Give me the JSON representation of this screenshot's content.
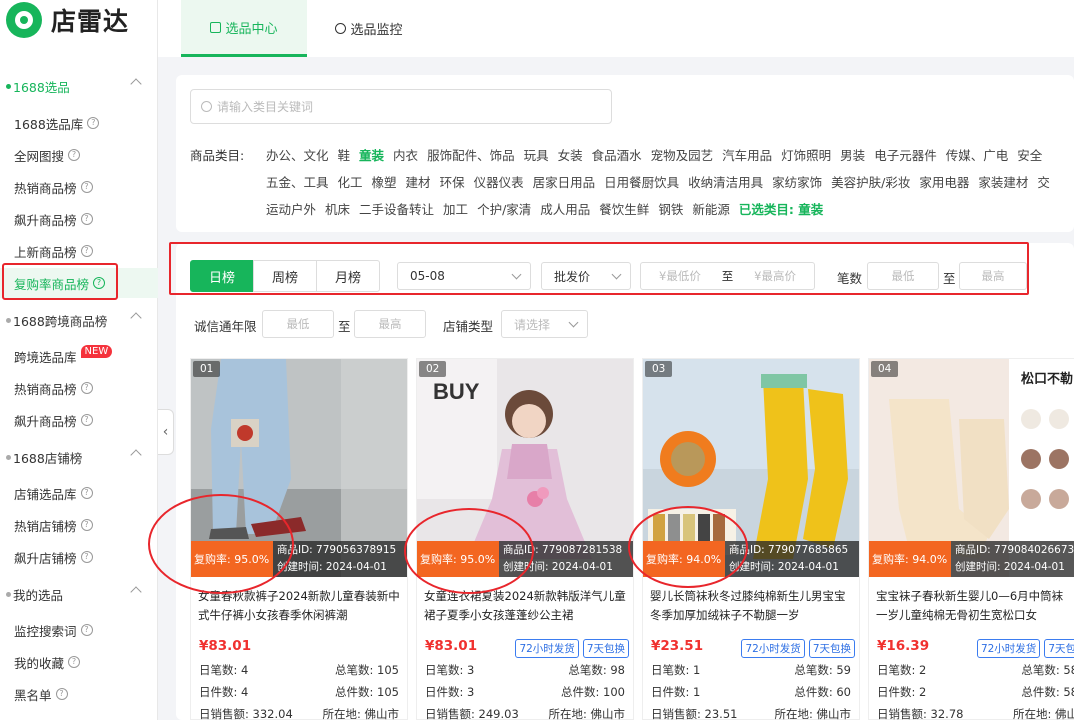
{
  "app": {
    "name": "店雷达"
  },
  "tabs": [
    {
      "label": "选品中心"
    },
    {
      "label": "选品监控"
    }
  ],
  "sidebar": {
    "groups": [
      {
        "label": "1688选品",
        "items": [
          {
            "label": "1688选品库"
          },
          {
            "label": "全网图搜"
          },
          {
            "label": "热销商品榜"
          },
          {
            "label": "飙升商品榜"
          },
          {
            "label": "上新商品榜"
          },
          {
            "label": "复购率商品榜"
          }
        ]
      },
      {
        "label": "1688跨境商品榜",
        "items": [
          {
            "label": "跨境选品库",
            "badge": "NEW"
          },
          {
            "label": "热销商品榜"
          },
          {
            "label": "飙升商品榜"
          }
        ]
      },
      {
        "label": "1688店铺榜",
        "items": [
          {
            "label": "店铺选品库"
          },
          {
            "label": "热销店铺榜"
          },
          {
            "label": "飙升店铺榜"
          }
        ]
      },
      {
        "label": "我的选品",
        "items": [
          {
            "label": "监控搜索词"
          },
          {
            "label": "我的收藏"
          },
          {
            "label": "黑名单"
          }
        ]
      }
    ],
    "help_glyph": "?",
    "collapse_glyph": "‹"
  },
  "search": {
    "placeholder": "请输入类目关键词"
  },
  "categories": {
    "label": "商品类目:",
    "row1": [
      "办公、文化",
      "鞋",
      "童装",
      "内衣",
      "服饰配件、饰品",
      "玩具",
      "女装",
      "食品酒水",
      "宠物及园艺",
      "汽车用品",
      "灯饰照明",
      "男装",
      "电子元器件",
      "传媒、广电",
      "安全"
    ],
    "row2": [
      "五金、工具",
      "化工",
      "橡塑",
      "建材",
      "环保",
      "仪器仪表",
      "居家日用品",
      "日用餐厨饮具",
      "收纳清洁用具",
      "家纺家饰",
      "美容护肤/彩妆",
      "家用电器",
      "家装建材",
      "交"
    ],
    "row3": [
      "运动户外",
      "机床",
      "二手设备转让",
      "加工",
      "个护/家清",
      "成人用品",
      "餐饮生鲜",
      "钢铁",
      "新能源"
    ],
    "selected": "童装",
    "chosen_text": "已选类目: 童装"
  },
  "filters": {
    "periods": [
      "日榜",
      "周榜",
      "月榜"
    ],
    "active_period": "日榜",
    "date": "05-08",
    "price_type": "批发价",
    "price_min": "¥最低价",
    "price_max": "¥最高价",
    "to": "至",
    "orders_label": "笔数",
    "orders_min": "最低",
    "orders_max": "最高",
    "cxt_label": "诚信通年限",
    "cxt_min": "最低",
    "cxt_max": "最高",
    "shop_type_label": "店铺类型",
    "shop_type_placeholder": "请选择"
  },
  "products": [
    {
      "rank": "01",
      "rate": "复购率: 95.0%",
      "id": "商品ID: 779056378915",
      "created": "创建时间: 2024-04-01",
      "title": "女童春秋款裤子2024新款儿童春装新中式牛仔裤小女孩春季休闲裤潮",
      "price": "¥83.01",
      "tags": [],
      "day_orders": "日笔数: 4",
      "total_orders": "总笔数: 105",
      "day_pieces": "日件数: 4",
      "total_pieces": "总件数: 105",
      "day_sales": "日销售额: 332.04",
      "location": "所在地: 佛山市"
    },
    {
      "rank": "02",
      "rate": "复购率: 95.0%",
      "id": "商品ID: 779087281538",
      "created": "创建时间: 2024-04-01",
      "title": "女童连衣裙夏装2024新款韩版洋气儿童裙子夏季小女孩蓬蓬纱公主裙",
      "price": "¥83.01",
      "tags": [
        "72小时发货",
        "7天包换"
      ],
      "day_orders": "日笔数: 3",
      "total_orders": "总笔数: 98",
      "day_pieces": "日件数: 3",
      "total_pieces": "总件数: 100",
      "day_sales": "日销售额: 249.03",
      "location": "所在地: 佛山市"
    },
    {
      "rank": "03",
      "rate": "复购率: 94.0%",
      "id": "商品ID: 779077685865",
      "created": "创建时间: 2024-04-01",
      "title": "婴儿长筒袜秋冬过膝纯棉新生儿男宝宝冬季加厚加绒袜子不勒腿一岁",
      "price": "¥23.51",
      "tags": [
        "72小时发货",
        "7天包换"
      ],
      "day_orders": "日笔数: 1",
      "total_orders": "总笔数: 59",
      "day_pieces": "日件数: 1",
      "total_pieces": "总件数: 60",
      "day_sales": "日销售额: 23.51",
      "location": "所在地: 佛山市"
    },
    {
      "rank": "04",
      "rate": "复购率: 94.0%",
      "id": "商品ID: 779084026673",
      "created": "创建时间: 2024-04-01",
      "title": "宝宝袜子春秋新生婴儿0—6月中筒袜一岁儿童纯棉无骨初生宽松口女",
      "price": "¥16.39",
      "tags": [
        "72小时发货",
        "7天包"
      ],
      "day_orders": "日笔数: 2",
      "total_orders": "总笔数: 58",
      "day_pieces": "日件数: 2",
      "total_pieces": "总件数: 58",
      "day_sales": "日销售额: 32.78",
      "location": "所在地: 佛山"
    }
  ],
  "image_texts": {
    "buy": "BUY",
    "sock_label": "松口不勒"
  }
}
